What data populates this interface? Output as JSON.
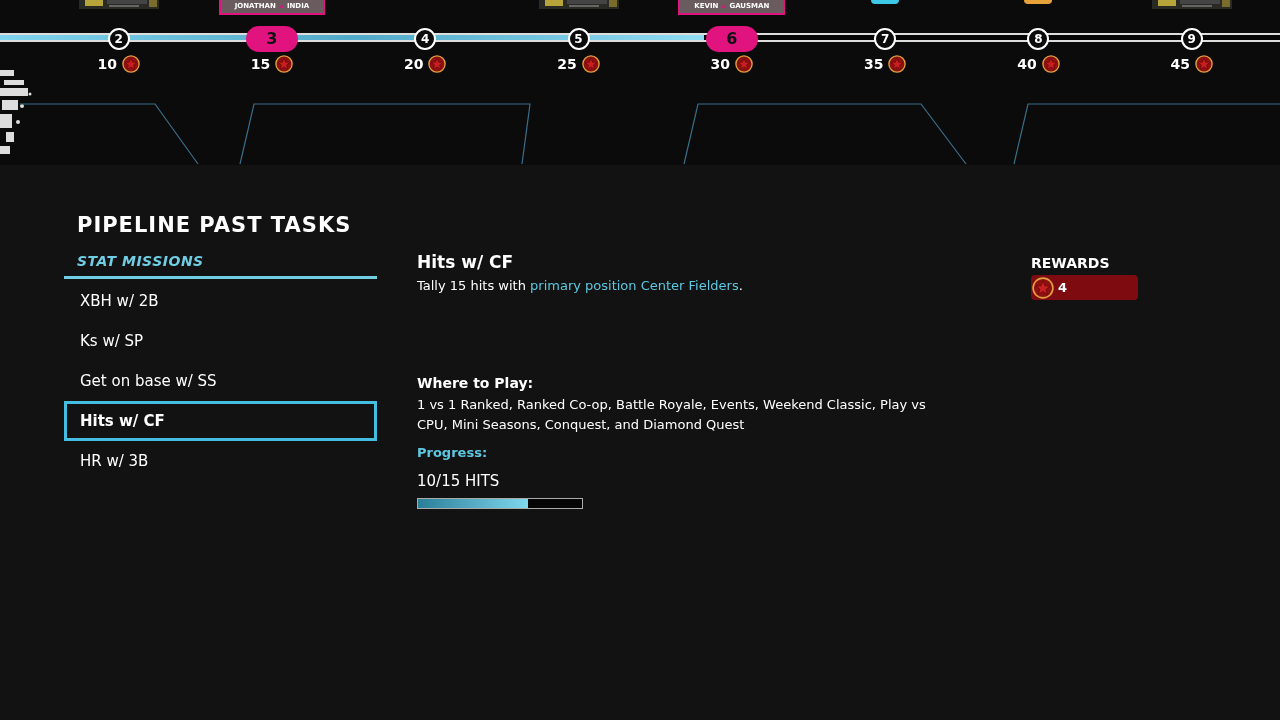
{
  "timeline": {
    "level": 0.55,
    "nodes": [
      {
        "label": "2",
        "milestone": false,
        "reward": "10"
      },
      {
        "label": "3",
        "milestone": true,
        "reward": "15",
        "top": {
          "kind": "player",
          "first": "JONATHAN",
          "last": "INDIA"
        }
      },
      {
        "label": "4",
        "milestone": false,
        "reward": "20",
        "top": {
          "kind": "none"
        }
      },
      {
        "label": "5",
        "milestone": false,
        "reward": "25"
      },
      {
        "label": "6",
        "milestone": true,
        "reward": "30",
        "top": {
          "kind": "player",
          "first": "KEVIN",
          "last": "GAUSMAN"
        }
      },
      {
        "label": "7",
        "milestone": false,
        "reward": "35",
        "top": {
          "kind": "token",
          "color": "#3cc8e6"
        }
      },
      {
        "label": "8",
        "milestone": false,
        "reward": "40",
        "top": {
          "kind": "token",
          "color": "#e8a23a"
        }
      },
      {
        "label": "9",
        "milestone": false,
        "reward": "45"
      }
    ]
  },
  "section": {
    "title": "PIPELINE PAST TASKS",
    "tab": "STAT MISSIONS",
    "tasks": [
      {
        "label": "XBH w/ 2B",
        "selected": false
      },
      {
        "label": "Ks w/ SP",
        "selected": false
      },
      {
        "label": "Get on base w/ SS",
        "selected": false
      },
      {
        "label": "Hits w/ CF",
        "selected": true
      },
      {
        "label": "HR w/ 3B",
        "selected": false
      }
    ]
  },
  "detail": {
    "title": "Hits w/ CF",
    "text_before": "Tally 15 hits with ",
    "link": "primary position Center Fielders",
    "text_after": ".",
    "where_heading": "Where to Play:",
    "where_text": "1 vs 1 Ranked, Ranked Co-op, Battle Royale, Events, Weekend Classic, Play vs CPU, Mini Seasons, Conquest, and Diamond Quest",
    "progress_heading": "Progress:",
    "progress_text": "10/15 HITS",
    "level": 0.67
  },
  "rewards": {
    "heading": "REWARDS",
    "amount": "4"
  }
}
